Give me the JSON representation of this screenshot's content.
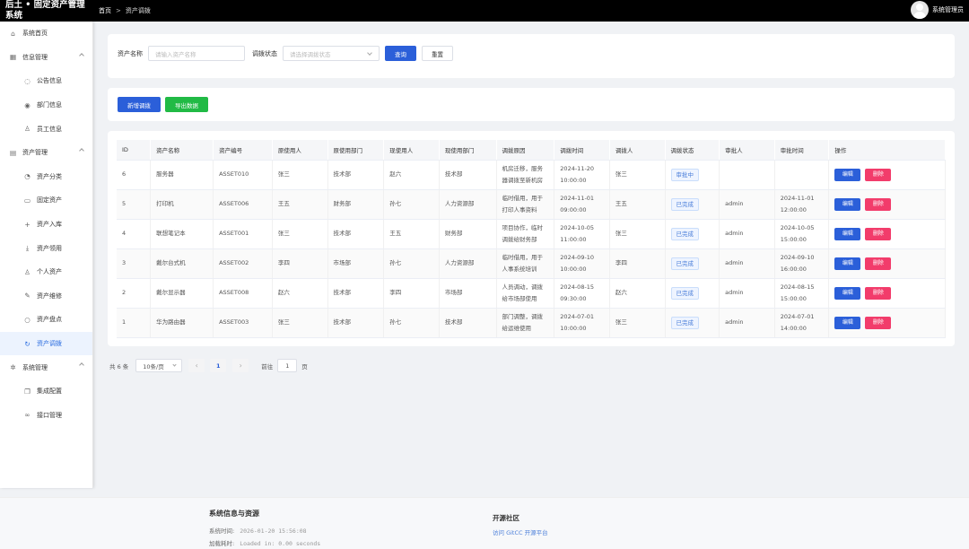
{
  "header": {
    "brand": "后土 • 固定资产管理系统",
    "breadcrumb_home": "首页",
    "breadcrumb_sep": ">",
    "breadcrumb_current": "资产调拨",
    "user": "系统管理员"
  },
  "sidebar": {
    "items": [
      {
        "label": "系统首页",
        "icon": "home-icon",
        "level": 0
      },
      {
        "label": "信息管理",
        "icon": "grid-icon",
        "level": 0,
        "expandable": true
      },
      {
        "label": "公告信息",
        "icon": "chat-icon",
        "level": 1
      },
      {
        "label": "部门信息",
        "icon": "eye-icon",
        "level": 1
      },
      {
        "label": "员工信息",
        "icon": "user-icon",
        "level": 1
      },
      {
        "label": "资产管理",
        "icon": "bank-icon",
        "level": 0,
        "expandable": true
      },
      {
        "label": "资产分类",
        "icon": "clock-icon",
        "level": 1
      },
      {
        "label": "固定资产",
        "icon": "document-icon",
        "level": 1
      },
      {
        "label": "资产入库",
        "icon": "plus-icon",
        "level": 1
      },
      {
        "label": "资产领用",
        "icon": "download-icon",
        "level": 1
      },
      {
        "label": "个人资产",
        "icon": "user-icon",
        "level": 1
      },
      {
        "label": "资产维修",
        "icon": "edit-icon",
        "level": 1
      },
      {
        "label": "资产盘点",
        "icon": "search-icon",
        "level": 1
      },
      {
        "label": "资产调拨",
        "icon": "refresh-icon",
        "level": 1,
        "active": true
      },
      {
        "label": "系统管理",
        "icon": "gear-icon",
        "level": 0,
        "expandable": true
      },
      {
        "label": "集成配置",
        "icon": "copy-icon",
        "level": 1
      },
      {
        "label": "接口管理",
        "icon": "link-icon",
        "level": 1
      }
    ]
  },
  "search": {
    "name_label": "资产名称",
    "name_placeholder": "请输入资产名称",
    "status_label": "调拨状态",
    "status_placeholder": "请选择调拨状态",
    "query_button": "查询",
    "reset_button": "重置"
  },
  "toolbar": {
    "add_button": "新增调拨",
    "export_button": "导出数据"
  },
  "table": {
    "headers": [
      "ID",
      "资产名称",
      "资产编号",
      "原使用人",
      "原使用部门",
      "现使用人",
      "现使用部门",
      "调拨原因",
      "调拨时间",
      "调拨人",
      "调拨状态",
      "审批人",
      "审批时间",
      "操作"
    ],
    "rows": [
      {
        "id": "6",
        "name": "服务器",
        "code": "ASSET010",
        "old_user": "张三",
        "old_dept": "技术部",
        "new_user": "赵六",
        "new_dept": "技术部",
        "reason": "机房迁移，服务器调拨至新机房",
        "time": "2024-11-20 10:00:00",
        "operator": "张三",
        "status": "审批中",
        "approver": "",
        "approve_time": "",
        "edit": "编辑",
        "delete": "删除"
      },
      {
        "id": "5",
        "name": "打印机",
        "code": "ASSET006",
        "old_user": "王五",
        "old_dept": "财务部",
        "new_user": "孙七",
        "new_dept": "人力资源部",
        "reason": "临时借用，用于打印人事资料",
        "time": "2024-11-01 09:00:00",
        "operator": "王五",
        "status": "已完成",
        "approver": "admin",
        "approve_time": "2024-11-01 12:00:00",
        "edit": "编辑",
        "delete": "删除"
      },
      {
        "id": "4",
        "name": "联想笔记本",
        "code": "ASSET001",
        "old_user": "张三",
        "old_dept": "技术部",
        "new_user": "王五",
        "new_dept": "财务部",
        "reason": "项目协作，临时调拨给财务部",
        "time": "2024-10-05 11:00:00",
        "operator": "张三",
        "status": "已完成",
        "approver": "admin",
        "approve_time": "2024-10-05 15:00:00",
        "edit": "编辑",
        "delete": "删除"
      },
      {
        "id": "3",
        "name": "戴尔台式机",
        "code": "ASSET002",
        "old_user": "李四",
        "old_dept": "市场部",
        "new_user": "孙七",
        "new_dept": "人力资源部",
        "reason": "临时借用，用于人事系统培训",
        "time": "2024-09-10 10:00:00",
        "operator": "李四",
        "status": "已完成",
        "approver": "admin",
        "approve_time": "2024-09-10 16:00:00",
        "edit": "编辑",
        "delete": "删除"
      },
      {
        "id": "2",
        "name": "戴尔显示器",
        "code": "ASSET008",
        "old_user": "赵六",
        "old_dept": "技术部",
        "new_user": "李四",
        "new_dept": "市场部",
        "reason": "人员调动，调拨给市场部使用",
        "time": "2024-08-15 09:30:00",
        "operator": "赵六",
        "status": "已完成",
        "approver": "admin",
        "approve_time": "2024-08-15 15:00:00",
        "edit": "编辑",
        "delete": "删除"
      },
      {
        "id": "1",
        "name": "华为路由器",
        "code": "ASSET003",
        "old_user": "张三",
        "old_dept": "技术部",
        "new_user": "孙七",
        "new_dept": "技术部",
        "reason": "部门调整，调拨给运维使用",
        "time": "2024-07-01 10:00:00",
        "operator": "张三",
        "status": "已完成",
        "approver": "admin",
        "approve_time": "2024-07-01 14:00:00",
        "edit": "编辑",
        "delete": "删除"
      }
    ]
  },
  "pagination": {
    "total": "共 6 条",
    "page_size": "10条/页",
    "prev": "‹",
    "current": "1",
    "next": "›",
    "goto_label": "前往",
    "goto_value": "1",
    "goto_suffix": "页"
  },
  "footer": {
    "title": "系统信息与资源",
    "time_label": "系统时间:",
    "time_value": "2026-01-20 15:56:08",
    "load_label": "加载耗时:",
    "load_value": "Loaded in: 0.00 seconds",
    "community_title": "开源社区",
    "community_link": "访问 GitCC 开源平台"
  },
  "colors": {
    "primary": "#2b5fd9",
    "danger": "#f23c6b",
    "success": "#21ba45",
    "active_bg": "#ecf3fe"
  }
}
